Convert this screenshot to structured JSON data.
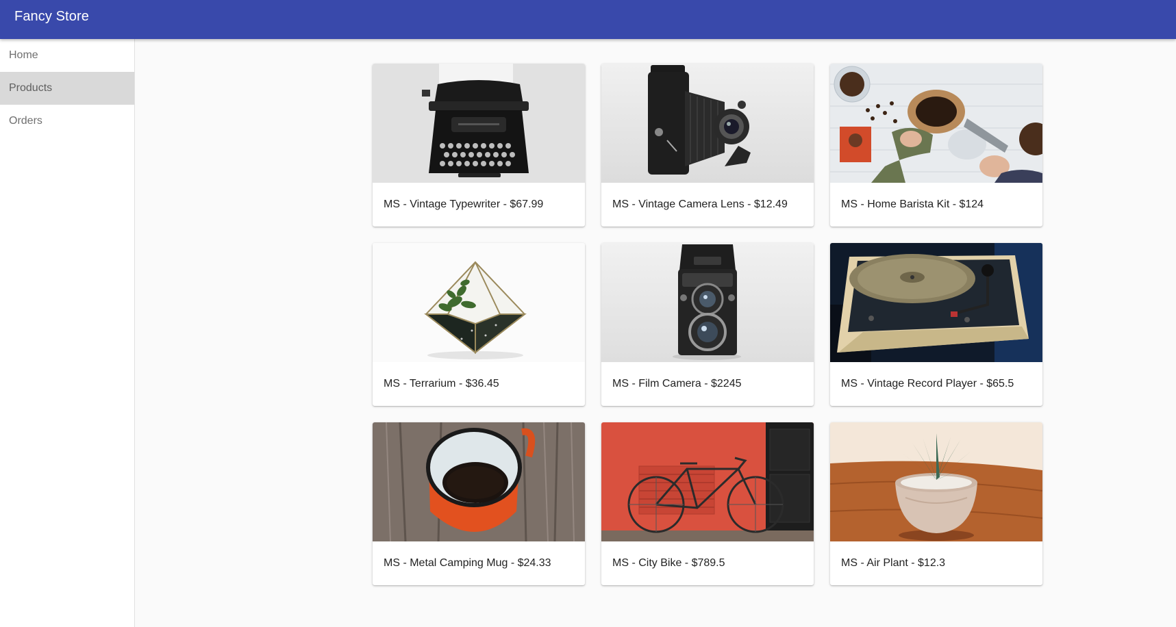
{
  "app": {
    "title": "Fancy Store"
  },
  "sidebar": {
    "items": [
      {
        "label": "Home",
        "active": false
      },
      {
        "label": "Products",
        "active": true
      },
      {
        "label": "Orders",
        "active": false
      }
    ]
  },
  "products": [
    {
      "label": "MS - Vintage Typewriter - $67.99",
      "image": "typewriter"
    },
    {
      "label": "MS - Vintage Camera Lens - $12.49",
      "image": "folding-camera"
    },
    {
      "label": "MS - Home Barista Kit - $124",
      "image": "barista-kit"
    },
    {
      "label": "MS - Terrarium - $36.45",
      "image": "terrarium"
    },
    {
      "label": "MS - Film Camera - $2245",
      "image": "film-camera"
    },
    {
      "label": "MS - Vintage Record Player - $65.5",
      "image": "record-player"
    },
    {
      "label": "MS - Metal Camping Mug - $24.33",
      "image": "camping-mug"
    },
    {
      "label": "MS - City Bike - $789.5",
      "image": "city-bike"
    },
    {
      "label": "MS - Air Plant - $12.3",
      "image": "air-plant"
    }
  ],
  "colors": {
    "app_bar": "#3949ab",
    "active_nav": "#d9d9d9",
    "background": "#fafafa"
  }
}
